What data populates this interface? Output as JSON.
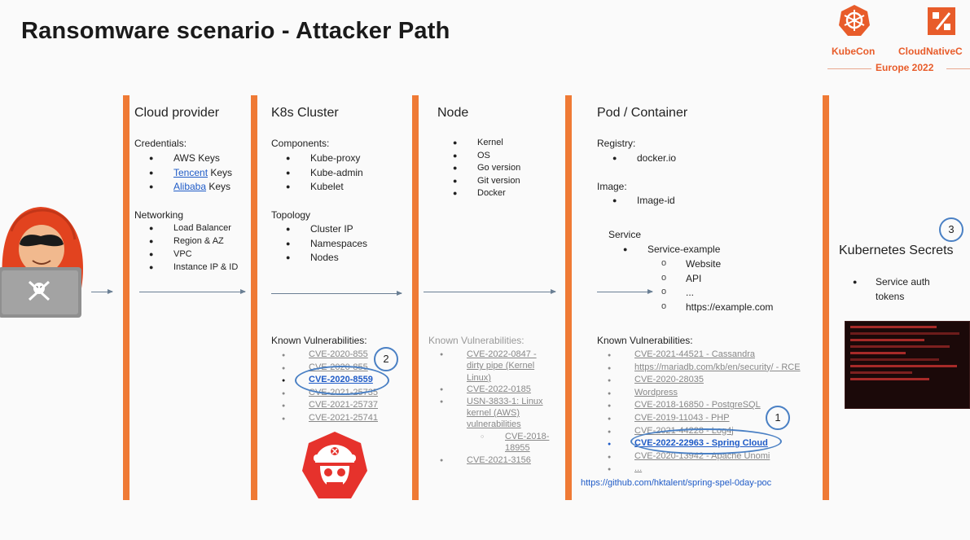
{
  "slide": {
    "title": "Ransomware scenario - Attacker Path",
    "logo_kubecon": "KubeCon",
    "logo_cloudnative": "CloudNativeC",
    "logo_europe": "Europe 2022"
  },
  "cloud": {
    "title": "Cloud provider",
    "credentials_head": "Credentials:",
    "cred_items": [
      "AWS Keys",
      " Keys",
      " Keys"
    ],
    "cred_links": [
      "Tencent",
      "Alibaba"
    ],
    "networking_head": "Networking",
    "net_items": [
      "Load Balancer",
      "Region & AZ",
      "VPC",
      "Instance IP & ID"
    ]
  },
  "k8s": {
    "title": "K8s Cluster",
    "components_head": "Components:",
    "components": [
      "Kube-proxy",
      "Kube-admin",
      "Kubelet"
    ],
    "topology_head": "Topology",
    "topology": [
      "Cluster IP",
      "Namespaces",
      "Nodes"
    ],
    "vuln_head": "Known Vulnerabilities:",
    "vulns": [
      "CVE-2020-855",
      "CVE-2020-855",
      "CVE-2020-8559",
      "CVE-2021-25735",
      "CVE-2021-25737",
      "CVE-2021-25741"
    ],
    "marker": "2"
  },
  "node": {
    "title": "Node",
    "items": [
      "Kernel",
      "OS",
      "Go version",
      "Git version",
      "Docker"
    ],
    "vuln_head": "Known Vulnerabilities:",
    "vulns": [
      "CVE-2022-0847 -",
      "dirty pipe (Kernel",
      "Linux)",
      "CVE-2022-0185",
      "USN-3833-1: Linux",
      "kernel (AWS)",
      "vulnerabilities",
      "CVE-2018-",
      "18955",
      "CVE-2021-3156"
    ]
  },
  "pod": {
    "title": "Pod / Container",
    "registry_head": "Registry:",
    "registry": [
      "docker.io"
    ],
    "image_head": "Image:",
    "image": [
      "Image-id"
    ],
    "service_head": "Service",
    "service": [
      "Service-example"
    ],
    "service_sub": [
      "Website",
      "API",
      "...",
      "https://example.com"
    ],
    "vuln_head": "Known Vulnerabilities:",
    "vulns": [
      "CVE-2021-44521 - Cassandra",
      "https://mariadb.com/kb/en/security/ - RCE",
      "CVE-2020-28035",
      "Wordpress",
      "CVE-2018-16850 - PostgreSQL",
      "CVE-2019-11043 - PHP",
      "CVE-2021-44228 - Log4j",
      "CVE-2022-22963 - Spring Cloud",
      "CVE-2020-13942 - Apache Unomi",
      "..."
    ],
    "marker": "1",
    "poc_url": "https://github.com/hktalent/spring-spel-0day-poc"
  },
  "secrets": {
    "title": "Kubernetes Secrets",
    "items": [
      "Service auth",
      "tokens"
    ],
    "marker": "3"
  },
  "colors": {
    "bar": "#ef7a35",
    "accent": "#e85c2a",
    "marker": "#4a80c4",
    "link": "#1f5bc7"
  }
}
